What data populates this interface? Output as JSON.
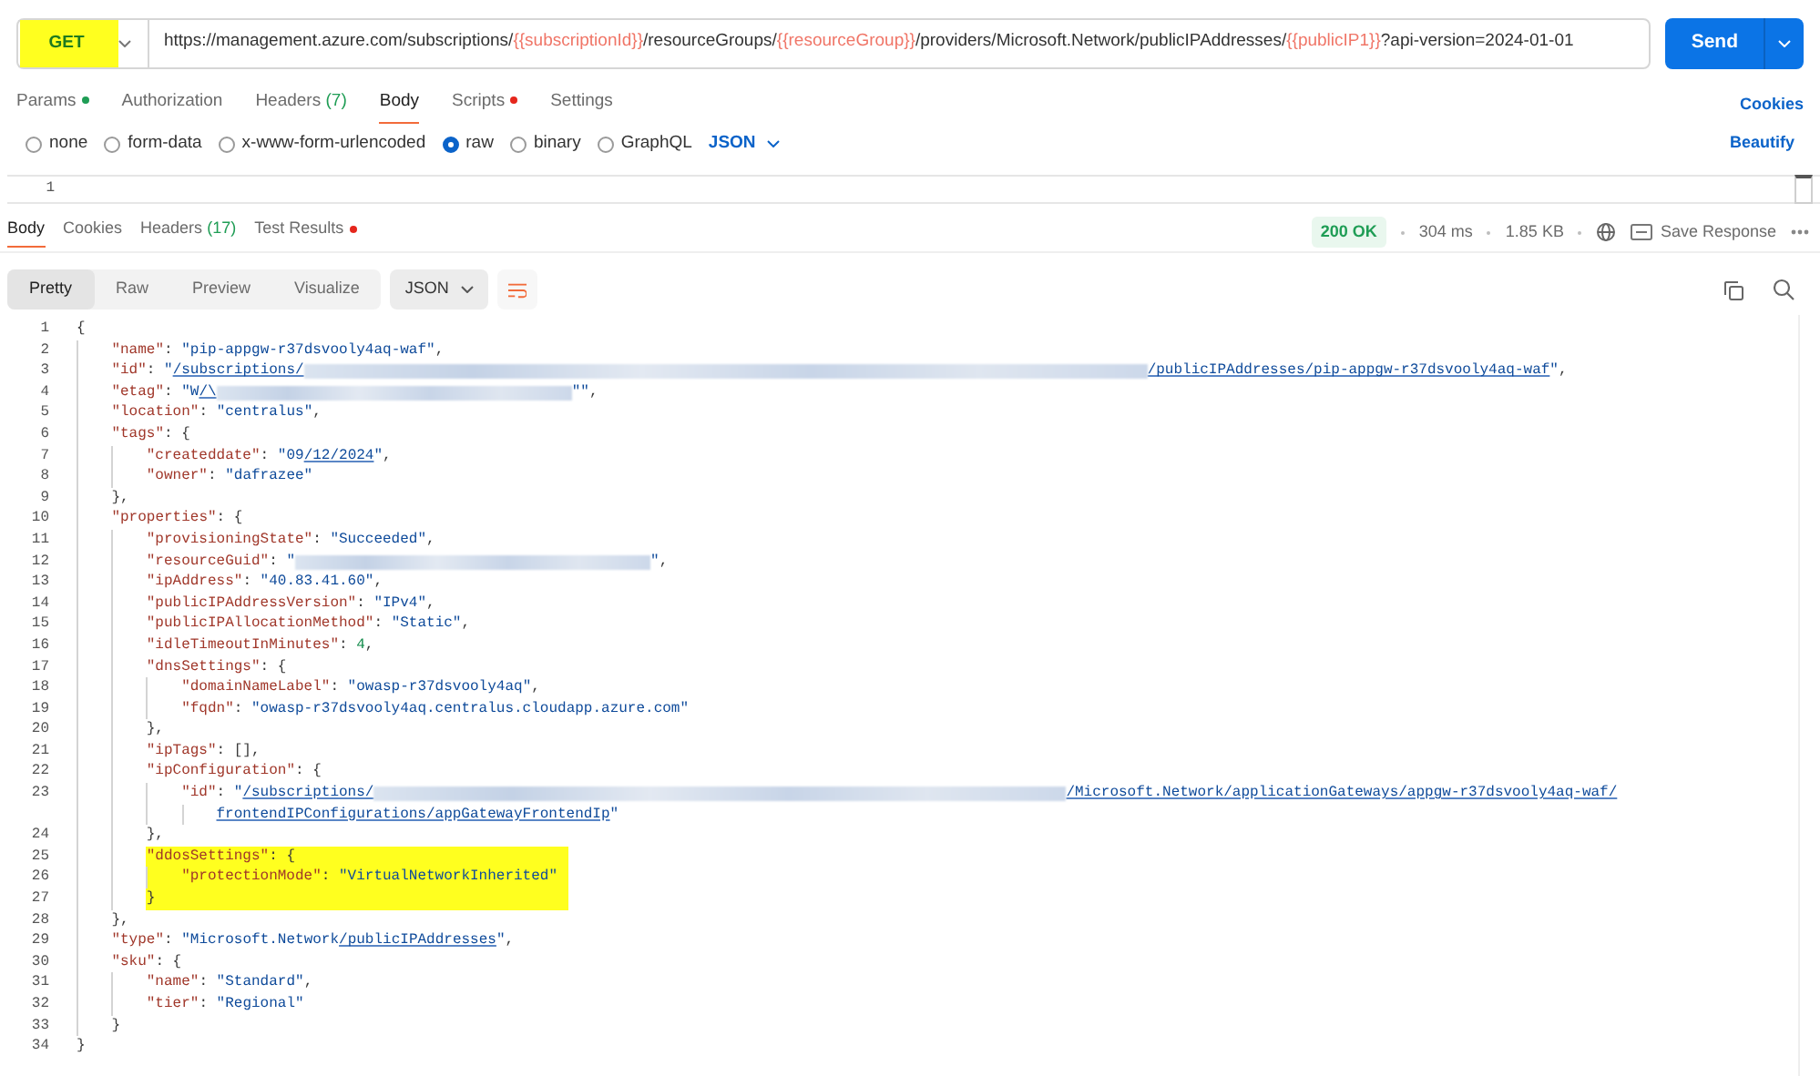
{
  "request": {
    "method": {
      "label": "GET",
      "highlighted": true
    },
    "url": [
      {
        "kind": "text",
        "text": "https://management.azure.com/subscriptions/"
      },
      {
        "kind": "variable",
        "text": "{{subscriptionId}}"
      },
      {
        "kind": "text",
        "text": "/resourceGroups/"
      },
      {
        "kind": "variable",
        "text": "{{resourceGroup}}"
      },
      {
        "kind": "text",
        "text": "/providers/Microsoft.Network/publicIPAddresses/"
      },
      {
        "kind": "variable",
        "text": "{{publicIP1}}"
      },
      {
        "kind": "text",
        "text": "?api-version=2024-01-01"
      }
    ],
    "send": "Send"
  },
  "request_tabs": [
    {
      "label": "Params",
      "selected": false,
      "dot": {
        "color": "#1f9d55"
      }
    },
    {
      "label": "Authorization",
      "selected": false
    },
    {
      "label": "Headers",
      "count": "(7)",
      "selected": false
    },
    {
      "label": "Body",
      "selected": true
    },
    {
      "label": "Scripts",
      "selected": false,
      "dot": {
        "color": "#e5261c"
      }
    },
    {
      "label": "Settings",
      "selected": false
    }
  ],
  "cookies_link": "Cookies",
  "body_types": [
    {
      "label": "none",
      "selected": false
    },
    {
      "label": "form-data",
      "selected": false
    },
    {
      "label": "x-www-form-urlencoded",
      "selected": false
    },
    {
      "label": "raw",
      "selected": true
    },
    {
      "label": "binary",
      "selected": false
    },
    {
      "label": "GraphQL",
      "selected": false
    }
  ],
  "body_format": "JSON",
  "beautify": "Beautify",
  "request_editor": {
    "line_numbers": [
      "1"
    ]
  },
  "response_tabs": [
    {
      "label": "Body",
      "selected": true
    },
    {
      "label": "Cookies",
      "selected": false
    },
    {
      "label": "Headers",
      "count": "(17)",
      "selected": false
    },
    {
      "label": "Test Results",
      "selected": false,
      "dot": {
        "color": "#e5261c"
      }
    }
  ],
  "response_meta": {
    "status": "200 OK",
    "time": "304 ms",
    "size": "1.85 KB",
    "save_response": "Save Response"
  },
  "view_modes": [
    {
      "label": "Pretty",
      "selected": true
    },
    {
      "label": "Raw",
      "selected": false
    },
    {
      "label": "Preview",
      "selected": false
    },
    {
      "label": "Visualize",
      "selected": false
    }
  ],
  "response_format": "JSON",
  "code": [
    {
      "number": "1",
      "tokens": [
        {
          "kind": "punct",
          "text": "{"
        }
      ],
      "children": [
        {
          "number": "2",
          "tokens": [
            {
              "kind": "key",
              "text": "\"name\""
            },
            {
              "kind": "punct",
              "text": ": "
            },
            {
              "kind": "string",
              "text": "\"pip-appgw-r37dsvooly4aq-waf\""
            },
            {
              "kind": "punct",
              "text": ","
            }
          ]
        },
        {
          "number": "3",
          "tokens": [
            {
              "kind": "key",
              "text": "\"id\""
            },
            {
              "kind": "punct",
              "text": ": "
            },
            {
              "kind": "string",
              "text": "\""
            },
            {
              "kind": "link",
              "text": "/subscriptions/"
            },
            {
              "kind": "redacted_long"
            },
            {
              "kind": "link",
              "text": "/publicIPAddresses/pip-appgw-r37dsvooly4aq-waf"
            },
            {
              "kind": "string",
              "text": "\""
            },
            {
              "kind": "punct",
              "text": ","
            }
          ]
        },
        {
          "number": "4",
          "tokens": [
            {
              "kind": "key",
              "text": "\"etag\""
            },
            {
              "kind": "punct",
              "text": ": "
            },
            {
              "kind": "string",
              "text": "\"W"
            },
            {
              "kind": "link",
              "text": "/\\"
            },
            {
              "kind": "redacted_medium"
            },
            {
              "kind": "string",
              "text": "\"\""
            },
            {
              "kind": "punct",
              "text": ","
            }
          ]
        },
        {
          "number": "5",
          "tokens": [
            {
              "kind": "key",
              "text": "\"location\""
            },
            {
              "kind": "punct",
              "text": ": "
            },
            {
              "kind": "string",
              "text": "\"centralus\""
            },
            {
              "kind": "punct",
              "text": ","
            }
          ]
        },
        {
          "number": "6",
          "tokens": [
            {
              "kind": "key",
              "text": "\"tags\""
            },
            {
              "kind": "punct",
              "text": ": {"
            }
          ],
          "children": [
            {
              "number": "7",
              "tokens": [
                {
                  "kind": "key",
                  "text": "\"createddate\""
                },
                {
                  "kind": "punct",
                  "text": ": "
                },
                {
                  "kind": "string",
                  "text": "\"09"
                },
                {
                  "kind": "link",
                  "text": "/12/2024"
                },
                {
                  "kind": "string",
                  "text": "\""
                },
                {
                  "kind": "punct",
                  "text": ","
                }
              ]
            },
            {
              "number": "8",
              "tokens": [
                {
                  "kind": "key",
                  "text": "\"owner\""
                },
                {
                  "kind": "punct",
                  "text": ": "
                },
                {
                  "kind": "string",
                  "text": "\"dafrazee\""
                }
              ]
            }
          ]
        },
        {
          "number": "9",
          "tokens": [
            {
              "kind": "punct",
              "text": "},"
            }
          ]
        },
        {
          "number": "10",
          "tokens": [
            {
              "kind": "key",
              "text": "\"properties\""
            },
            {
              "kind": "punct",
              "text": ": {"
            }
          ],
          "children": [
            {
              "number": "11",
              "tokens": [
                {
                  "kind": "key",
                  "text": "\"provisioningState\""
                },
                {
                  "kind": "punct",
                  "text": ": "
                },
                {
                  "kind": "string",
                  "text": "\"Succeeded\""
                },
                {
                  "kind": "punct",
                  "text": ","
                }
              ]
            },
            {
              "number": "12",
              "tokens": [
                {
                  "kind": "key",
                  "text": "\"resourceGuid\""
                },
                {
                  "kind": "punct",
                  "text": ": "
                },
                {
                  "kind": "string",
                  "text": "\""
                },
                {
                  "kind": "redacted_medium"
                },
                {
                  "kind": "string",
                  "text": "\""
                },
                {
                  "kind": "punct",
                  "text": ","
                }
              ]
            },
            {
              "number": "13",
              "tokens": [
                {
                  "kind": "key",
                  "text": "\"ipAddress\""
                },
                {
                  "kind": "punct",
                  "text": ": "
                },
                {
                  "kind": "string",
                  "text": "\"40.83.41.60\""
                },
                {
                  "kind": "punct",
                  "text": ","
                }
              ]
            },
            {
              "number": "14",
              "tokens": [
                {
                  "kind": "key",
                  "text": "\"publicIPAddressVersion\""
                },
                {
                  "kind": "punct",
                  "text": ": "
                },
                {
                  "kind": "string",
                  "text": "\"IPv4\""
                },
                {
                  "kind": "punct",
                  "text": ","
                }
              ]
            },
            {
              "number": "15",
              "tokens": [
                {
                  "kind": "key",
                  "text": "\"publicIPAllocationMethod\""
                },
                {
                  "kind": "punct",
                  "text": ": "
                },
                {
                  "kind": "string",
                  "text": "\"Static\""
                },
                {
                  "kind": "punct",
                  "text": ","
                }
              ]
            },
            {
              "number": "16",
              "tokens": [
                {
                  "kind": "key",
                  "text": "\"idleTimeoutInMinutes\""
                },
                {
                  "kind": "punct",
                  "text": ": "
                },
                {
                  "kind": "number",
                  "text": "4"
                },
                {
                  "kind": "punct",
                  "text": ","
                }
              ]
            },
            {
              "number": "17",
              "tokens": [
                {
                  "kind": "key",
                  "text": "\"dnsSettings\""
                },
                {
                  "kind": "punct",
                  "text": ": {"
                }
              ],
              "children": [
                {
                  "number": "18",
                  "tokens": [
                    {
                      "kind": "key",
                      "text": "\"domainNameLabel\""
                    },
                    {
                      "kind": "punct",
                      "text": ": "
                    },
                    {
                      "kind": "string",
                      "text": "\"owasp-r37dsvooly4aq\""
                    },
                    {
                      "kind": "punct",
                      "text": ","
                    }
                  ]
                },
                {
                  "number": "19",
                  "tokens": [
                    {
                      "kind": "key",
                      "text": "\"fqdn\""
                    },
                    {
                      "kind": "punct",
                      "text": ": "
                    },
                    {
                      "kind": "string",
                      "text": "\"owasp-r37dsvooly4aq.centralus.cloudapp.azure.com\""
                    }
                  ]
                }
              ]
            },
            {
              "number": "20",
              "tokens": [
                {
                  "kind": "punct",
                  "text": "},"
                }
              ]
            },
            {
              "number": "21",
              "tokens": [
                {
                  "kind": "key",
                  "text": "\"ipTags\""
                },
                {
                  "kind": "punct",
                  "text": ": [],"
                }
              ]
            },
            {
              "number": "22",
              "tokens": [
                {
                  "kind": "key",
                  "text": "\"ipConfiguration\""
                },
                {
                  "kind": "punct",
                  "text": ": {"
                }
              ],
              "children": [
                {
                  "number": "23",
                  "tokens": [
                    {
                      "kind": "key",
                      "text": "\"id\""
                    },
                    {
                      "kind": "punct",
                      "text": ": "
                    },
                    {
                      "kind": "string",
                      "text": "\""
                    },
                    {
                      "kind": "link",
                      "text": "/subscriptions/"
                    },
                    {
                      "kind": "redacted_wide"
                    },
                    {
                      "kind": "link",
                      "text": "/Microsoft.Network/applicationGateways/appgw-r37dsvooly4aq-waf/"
                    }
                  ],
                  "continuation": [
                    {
                      "kind": "link",
                      "text": "frontendIPConfigurations/appGatewayFrontendIp"
                    },
                    {
                      "kind": "string",
                      "text": "\""
                    }
                  ]
                }
              ]
            },
            {
              "number": "24",
              "tokens": [
                {
                  "kind": "punct",
                  "text": "},"
                }
              ]
            },
            {
              "number": "25",
              "highlighted": true,
              "tokens": [
                {
                  "kind": "key",
                  "text": "\"ddosSettings\""
                },
                {
                  "kind": "punct",
                  "text": ": {"
                }
              ],
              "children": [
                {
                  "number": "26",
                  "highlighted": true,
                  "tokens": [
                    {
                      "kind": "key",
                      "text": "\"protectionMode\""
                    },
                    {
                      "kind": "punct",
                      "text": ": "
                    },
                    {
                      "kind": "string",
                      "text": "\"VirtualNetworkInherited\""
                    }
                  ]
                }
              ]
            },
            {
              "number": "27",
              "highlighted": true,
              "tokens": [
                {
                  "kind": "punct",
                  "text": "}"
                }
              ]
            }
          ]
        },
        {
          "number": "28",
          "tokens": [
            {
              "kind": "punct",
              "text": "},"
            }
          ]
        },
        {
          "number": "29",
          "tokens": [
            {
              "kind": "key",
              "text": "\"type\""
            },
            {
              "kind": "punct",
              "text": ": "
            },
            {
              "kind": "string",
              "text": "\"Microsoft.Network"
            },
            {
              "kind": "link",
              "text": "/publicIPAddresses"
            },
            {
              "kind": "string",
              "text": "\""
            },
            {
              "kind": "punct",
              "text": ","
            }
          ]
        },
        {
          "number": "30",
          "tokens": [
            {
              "kind": "key",
              "text": "\"sku\""
            },
            {
              "kind": "punct",
              "text": ": {"
            }
          ],
          "children": [
            {
              "number": "31",
              "tokens": [
                {
                  "kind": "key",
                  "text": "\"name\""
                },
                {
                  "kind": "punct",
                  "text": ": "
                },
                {
                  "kind": "string",
                  "text": "\"Standard\""
                },
                {
                  "kind": "punct",
                  "text": ","
                }
              ]
            },
            {
              "number": "32",
              "tokens": [
                {
                  "kind": "key",
                  "text": "\"tier\""
                },
                {
                  "kind": "punct",
                  "text": ": "
                },
                {
                  "kind": "string",
                  "text": "\"Regional\""
                }
              ]
            }
          ]
        },
        {
          "number": "33",
          "tokens": [
            {
              "kind": "punct",
              "text": "}"
            }
          ]
        }
      ]
    },
    {
      "number": "34",
      "tokens": [
        {
          "kind": "punct",
          "text": "}"
        }
      ]
    }
  ]
}
